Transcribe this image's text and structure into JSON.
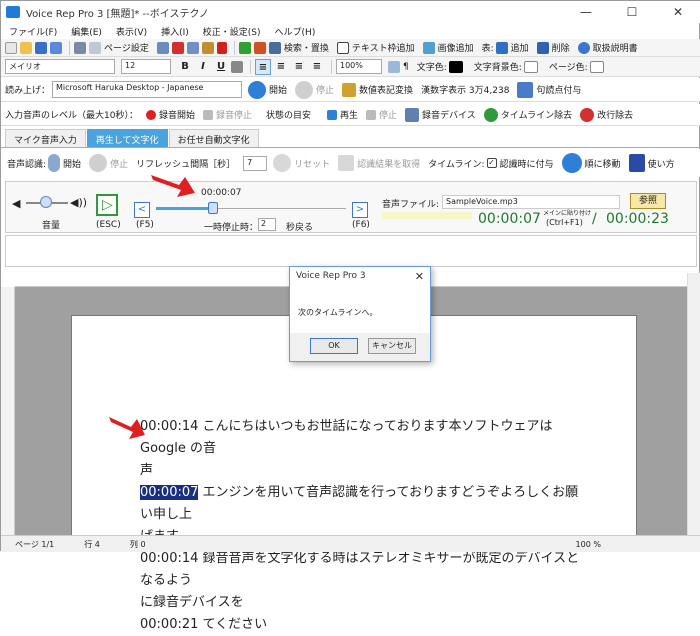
{
  "window": {
    "title": "Voice Rep Pro 3 [無題]* --ボイステクノ",
    "minimize": "—",
    "maximize": "☐",
    "close": "✕"
  },
  "menu": [
    "ファイル(F)",
    "編集(E)",
    "表示(V)",
    "挿入(I)",
    "校正・設定(S)",
    "ヘルプ(H)"
  ],
  "toolbar1": {
    "page_setup": "ページ設定",
    "search_replace": "検索・置換",
    "text_frame_add": "テキスト枠追加",
    "image_add": "画像追加",
    "table_label": "表:",
    "add": "追加",
    "delete": "削除",
    "manual": "取扱説明書"
  },
  "toolbar2": {
    "font": "メイリオ",
    "size": "12",
    "zoom": "100%",
    "text_color": "文字色:",
    "text_bg_color": "文字背景色:",
    "page_color": "ページ色:",
    "b": "B",
    "i": "I",
    "u": "U",
    "pilcrow": "¶"
  },
  "toolbar3": {
    "read_label": "読み上げ：",
    "voice": "Microsoft Haruka Desktop - Japanese",
    "start": "開始",
    "stop": "停止",
    "numeric_convert": "数値表記変換",
    "numeric_example": "漢数字表示 3万4,238",
    "punctuation": "句読点付与"
  },
  "toolbar4": {
    "level_label": "入力音声のレベル（最大10秒）：",
    "rec_start": "録音開始",
    "rec_stop": "録音停止",
    "state_label": "状態の目安",
    "play": "再生",
    "stop": "停止",
    "rec_device": "録音デバイス",
    "timeline_remove": "タイムライン除去",
    "newline_remove": "改行除去"
  },
  "tabs": [
    "マイク音声入力",
    "再生して文字化",
    "お任せ自動文字化"
  ],
  "voicebar": {
    "recog_label": "音声認識:",
    "start": "開始",
    "stop": "停止",
    "refresh_label": "リフレッシュ間隔［秒］",
    "refresh_value": "7",
    "reset": "リセット",
    "get_result": "認識結果を取得",
    "timeline_label": "タイムライン:",
    "add_on_recog": "認識時に付与",
    "move_in_order": "順に移動",
    "howto": "使い方"
  },
  "player": {
    "volume_label": "音量",
    "esc_label": "(ESC)",
    "f5_label": "(F5)",
    "f6_label": "(F6)",
    "position_time": "00:00:07",
    "pause_label": "一時停止時：",
    "pause_value": "2",
    "rewind_label": "秒戻る",
    "audio_file_label": "音声ファイル:",
    "audio_file": "SampleVoice.mp3",
    "browse": "参照",
    "current_time": "00:00:07",
    "paste_hint": "メインに貼り付け",
    "paste_shortcut": "(Ctrl+F1)",
    "slash": "/",
    "total_time": "00:00:23",
    "progress_percent": 30
  },
  "document": {
    "lines": [
      {
        "ts": "00:00:14",
        "text": "  こんにちはいつもお世話になっております本ソフトウェアは Google の音"
      },
      {
        "ts": "",
        "text": "声"
      },
      {
        "ts": "00:00:07",
        "text": " エンジンを用いて音声認識を行っておりますどうぞよろしくお願い申し上",
        "highlight": true
      },
      {
        "ts": "",
        "text": "げます"
      },
      {
        "ts": "00:00:14",
        "text": "  録音音声を文字化する時はステレオミキサーが既定のデバイスとなるよう"
      },
      {
        "ts": "",
        "text": "に録音デバイスを"
      },
      {
        "ts": "00:00:21",
        "text": "  てください"
      }
    ]
  },
  "dialog": {
    "title": "Voice Rep Pro 3",
    "message": "次のタイムラインへ。",
    "ok": "OK",
    "cancel": "キャンセル",
    "close": "✕"
  },
  "status": {
    "page": "ページ 1/1",
    "row": "行 4",
    "col": "列 0",
    "zoom": "100 %"
  },
  "colors": {
    "accent": "#4aa3df",
    "highlight": "#1a2f80",
    "time_green": "#1e7a2e",
    "arrow": "#e02020"
  }
}
